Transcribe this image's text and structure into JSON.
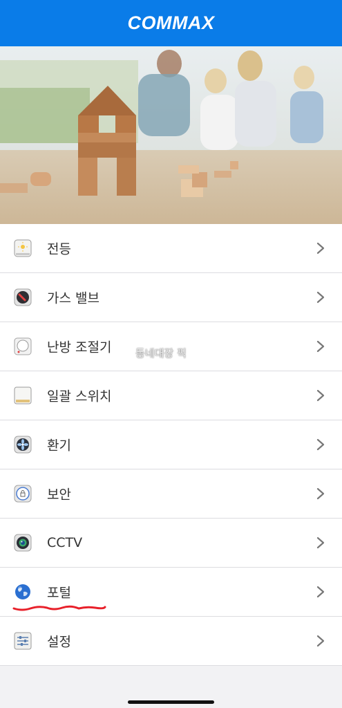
{
  "header": {
    "logo": "COMMAX",
    "bg_color": "#0a7ce8"
  },
  "hero": {
    "icon": "family-playing-blocks-photo"
  },
  "menu": {
    "items": [
      {
        "label": "전등",
        "icon": "light-icon"
      },
      {
        "label": "가스 밸브",
        "icon": "gas-valve-icon"
      },
      {
        "label": "난방 조절기",
        "icon": "thermostat-icon"
      },
      {
        "label": "일괄 스위치",
        "icon": "master-switch-icon"
      },
      {
        "label": "환기",
        "icon": "fan-icon"
      },
      {
        "label": "보안",
        "icon": "lock-icon"
      },
      {
        "label": "CCTV",
        "icon": "camera-icon"
      },
      {
        "label": "포털",
        "icon": "globe-icon"
      },
      {
        "label": "설정",
        "icon": "settings-icon"
      }
    ]
  },
  "watermark": "동네대장 픽"
}
